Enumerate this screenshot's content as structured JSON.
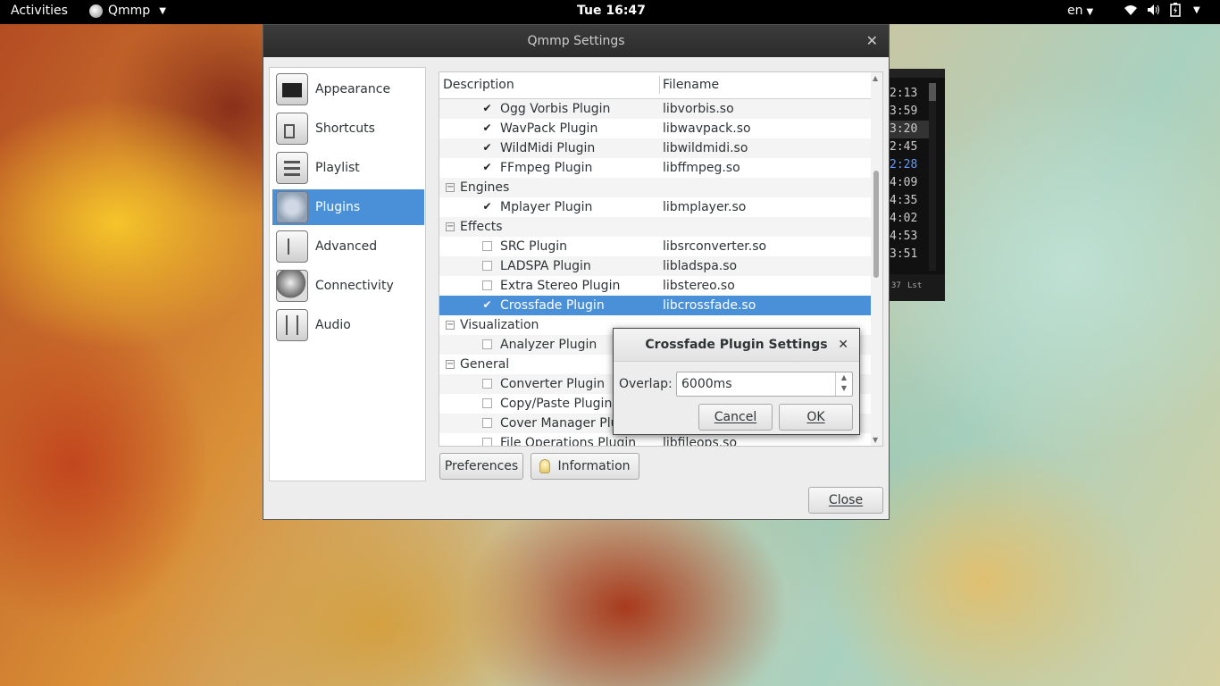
{
  "topbar": {
    "activities": "Activities",
    "app_name": "Qmmp",
    "clock": "Tue 16:47",
    "lang": "en"
  },
  "mini_player": {
    "times": [
      "2:13",
      "3:59",
      "3:20",
      "2:45",
      "2:28",
      "4:09",
      "4:35",
      "4:02",
      "4:53",
      "3:51"
    ],
    "footer_left": "37",
    "footer_right": "Lst"
  },
  "window": {
    "title": "Qmmp Settings",
    "sidebar": [
      {
        "label": "Appearance"
      },
      {
        "label": "Shortcuts"
      },
      {
        "label": "Playlist"
      },
      {
        "label": "Plugins"
      },
      {
        "label": "Advanced"
      },
      {
        "label": "Connectivity"
      },
      {
        "label": "Audio"
      }
    ],
    "table": {
      "col_description": "Description",
      "col_filename": "Filename",
      "rows": [
        {
          "type": "plugin",
          "desc": "Ogg Vorbis Plugin",
          "file": "libvorbis.so",
          "checked": true
        },
        {
          "type": "plugin",
          "desc": "WavPack Plugin",
          "file": "libwavpack.so",
          "checked": true
        },
        {
          "type": "plugin",
          "desc": "WildMidi Plugin",
          "file": "libwildmidi.so",
          "checked": true
        },
        {
          "type": "plugin",
          "desc": "FFmpeg Plugin",
          "file": "libffmpeg.so",
          "checked": true
        },
        {
          "type": "group",
          "desc": "Engines"
        },
        {
          "type": "plugin",
          "desc": "Mplayer Plugin",
          "file": "libmplayer.so",
          "checked": true
        },
        {
          "type": "group",
          "desc": "Effects"
        },
        {
          "type": "plugin",
          "desc": "SRC Plugin",
          "file": "libsrconverter.so",
          "checked": false
        },
        {
          "type": "plugin",
          "desc": "LADSPA Plugin",
          "file": "libladspa.so",
          "checked": false
        },
        {
          "type": "plugin",
          "desc": "Extra Stereo Plugin",
          "file": "libstereo.so",
          "checked": false
        },
        {
          "type": "plugin",
          "desc": "Crossfade Plugin",
          "file": "libcrossfade.so",
          "checked": true,
          "selected": true
        },
        {
          "type": "group",
          "desc": "Visualization"
        },
        {
          "type": "plugin",
          "desc": "Analyzer Plugin",
          "file": "",
          "checked": false
        },
        {
          "type": "group",
          "desc": "General"
        },
        {
          "type": "plugin",
          "desc": "Converter Plugin",
          "file": "",
          "checked": false
        },
        {
          "type": "plugin",
          "desc": "Copy/Paste Plugin",
          "file": "",
          "checked": false
        },
        {
          "type": "plugin",
          "desc": "Cover Manager Plu",
          "file": "",
          "checked": false
        },
        {
          "type": "plugin",
          "desc": "File Operations Plugin",
          "file": "libfileops.so",
          "checked": false
        }
      ]
    },
    "buttons": {
      "preferences": "Preferences",
      "information": "Information",
      "close": "Close"
    }
  },
  "dialog": {
    "title": "Crossfade Plugin Settings",
    "overlap_label": "Overlap:",
    "overlap_value": "6000ms",
    "cancel": "Cancel",
    "ok": "OK"
  }
}
